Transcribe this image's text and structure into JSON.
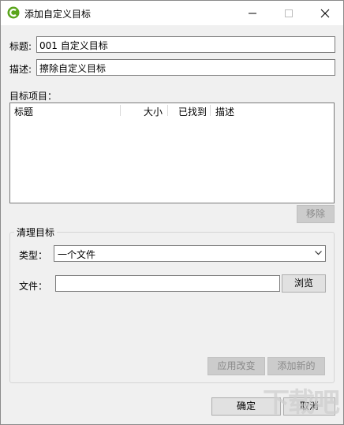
{
  "window": {
    "title": "添加自定义目标"
  },
  "form": {
    "title_label": "标题:",
    "title_value": "001 自定义目标",
    "desc_label": "描述:",
    "desc_value": "擦除自定义目标"
  },
  "items": {
    "label": "目标项目：",
    "columns": [
      "标题",
      "大小",
      "已找到",
      "描述"
    ],
    "remove_label": "移除"
  },
  "clean": {
    "group_title": "清理目标",
    "type_label": "类型：",
    "type_value": "一个文件",
    "file_label": "文件：",
    "file_value": "",
    "browse_label": "浏览",
    "apply_label": "应用改变",
    "add_new_label": "添加新的"
  },
  "footer": {
    "ok_label": "确定",
    "cancel_label": "取消"
  },
  "watermark": "下载吧",
  "icons": [
    "app-logo-icon",
    "minimize-icon",
    "maximize-icon",
    "close-icon",
    "chevron-down-icon"
  ]
}
